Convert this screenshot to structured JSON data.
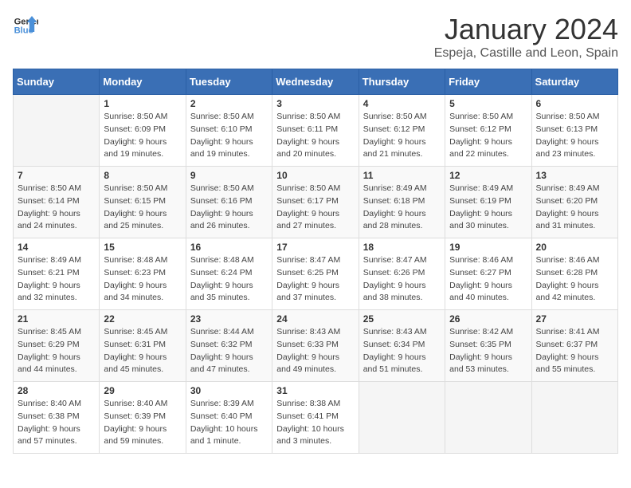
{
  "logo": {
    "line1": "General",
    "line2": "Blue"
  },
  "title": "January 2024",
  "location": "Espeja, Castille and Leon, Spain",
  "days_of_week": [
    "Sunday",
    "Monday",
    "Tuesday",
    "Wednesday",
    "Thursday",
    "Friday",
    "Saturday"
  ],
  "weeks": [
    [
      {
        "day": "",
        "sunrise": "",
        "sunset": "",
        "daylight": ""
      },
      {
        "day": "1",
        "sunrise": "Sunrise: 8:50 AM",
        "sunset": "Sunset: 6:09 PM",
        "daylight": "Daylight: 9 hours and 19 minutes."
      },
      {
        "day": "2",
        "sunrise": "Sunrise: 8:50 AM",
        "sunset": "Sunset: 6:10 PM",
        "daylight": "Daylight: 9 hours and 19 minutes."
      },
      {
        "day": "3",
        "sunrise": "Sunrise: 8:50 AM",
        "sunset": "Sunset: 6:11 PM",
        "daylight": "Daylight: 9 hours and 20 minutes."
      },
      {
        "day": "4",
        "sunrise": "Sunrise: 8:50 AM",
        "sunset": "Sunset: 6:12 PM",
        "daylight": "Daylight: 9 hours and 21 minutes."
      },
      {
        "day": "5",
        "sunrise": "Sunrise: 8:50 AM",
        "sunset": "Sunset: 6:12 PM",
        "daylight": "Daylight: 9 hours and 22 minutes."
      },
      {
        "day": "6",
        "sunrise": "Sunrise: 8:50 AM",
        "sunset": "Sunset: 6:13 PM",
        "daylight": "Daylight: 9 hours and 23 minutes."
      }
    ],
    [
      {
        "day": "7",
        "sunrise": "Sunrise: 8:50 AM",
        "sunset": "Sunset: 6:14 PM",
        "daylight": "Daylight: 9 hours and 24 minutes."
      },
      {
        "day": "8",
        "sunrise": "Sunrise: 8:50 AM",
        "sunset": "Sunset: 6:15 PM",
        "daylight": "Daylight: 9 hours and 25 minutes."
      },
      {
        "day": "9",
        "sunrise": "Sunrise: 8:50 AM",
        "sunset": "Sunset: 6:16 PM",
        "daylight": "Daylight: 9 hours and 26 minutes."
      },
      {
        "day": "10",
        "sunrise": "Sunrise: 8:50 AM",
        "sunset": "Sunset: 6:17 PM",
        "daylight": "Daylight: 9 hours and 27 minutes."
      },
      {
        "day": "11",
        "sunrise": "Sunrise: 8:49 AM",
        "sunset": "Sunset: 6:18 PM",
        "daylight": "Daylight: 9 hours and 28 minutes."
      },
      {
        "day": "12",
        "sunrise": "Sunrise: 8:49 AM",
        "sunset": "Sunset: 6:19 PM",
        "daylight": "Daylight: 9 hours and 30 minutes."
      },
      {
        "day": "13",
        "sunrise": "Sunrise: 8:49 AM",
        "sunset": "Sunset: 6:20 PM",
        "daylight": "Daylight: 9 hours and 31 minutes."
      }
    ],
    [
      {
        "day": "14",
        "sunrise": "Sunrise: 8:49 AM",
        "sunset": "Sunset: 6:21 PM",
        "daylight": "Daylight: 9 hours and 32 minutes."
      },
      {
        "day": "15",
        "sunrise": "Sunrise: 8:48 AM",
        "sunset": "Sunset: 6:23 PM",
        "daylight": "Daylight: 9 hours and 34 minutes."
      },
      {
        "day": "16",
        "sunrise": "Sunrise: 8:48 AM",
        "sunset": "Sunset: 6:24 PM",
        "daylight": "Daylight: 9 hours and 35 minutes."
      },
      {
        "day": "17",
        "sunrise": "Sunrise: 8:47 AM",
        "sunset": "Sunset: 6:25 PM",
        "daylight": "Daylight: 9 hours and 37 minutes."
      },
      {
        "day": "18",
        "sunrise": "Sunrise: 8:47 AM",
        "sunset": "Sunset: 6:26 PM",
        "daylight": "Daylight: 9 hours and 38 minutes."
      },
      {
        "day": "19",
        "sunrise": "Sunrise: 8:46 AM",
        "sunset": "Sunset: 6:27 PM",
        "daylight": "Daylight: 9 hours and 40 minutes."
      },
      {
        "day": "20",
        "sunrise": "Sunrise: 8:46 AM",
        "sunset": "Sunset: 6:28 PM",
        "daylight": "Daylight: 9 hours and 42 minutes."
      }
    ],
    [
      {
        "day": "21",
        "sunrise": "Sunrise: 8:45 AM",
        "sunset": "Sunset: 6:29 PM",
        "daylight": "Daylight: 9 hours and 44 minutes."
      },
      {
        "day": "22",
        "sunrise": "Sunrise: 8:45 AM",
        "sunset": "Sunset: 6:31 PM",
        "daylight": "Daylight: 9 hours and 45 minutes."
      },
      {
        "day": "23",
        "sunrise": "Sunrise: 8:44 AM",
        "sunset": "Sunset: 6:32 PM",
        "daylight": "Daylight: 9 hours and 47 minutes."
      },
      {
        "day": "24",
        "sunrise": "Sunrise: 8:43 AM",
        "sunset": "Sunset: 6:33 PM",
        "daylight": "Daylight: 9 hours and 49 minutes."
      },
      {
        "day": "25",
        "sunrise": "Sunrise: 8:43 AM",
        "sunset": "Sunset: 6:34 PM",
        "daylight": "Daylight: 9 hours and 51 minutes."
      },
      {
        "day": "26",
        "sunrise": "Sunrise: 8:42 AM",
        "sunset": "Sunset: 6:35 PM",
        "daylight": "Daylight: 9 hours and 53 minutes."
      },
      {
        "day": "27",
        "sunrise": "Sunrise: 8:41 AM",
        "sunset": "Sunset: 6:37 PM",
        "daylight": "Daylight: 9 hours and 55 minutes."
      }
    ],
    [
      {
        "day": "28",
        "sunrise": "Sunrise: 8:40 AM",
        "sunset": "Sunset: 6:38 PM",
        "daylight": "Daylight: 9 hours and 57 minutes."
      },
      {
        "day": "29",
        "sunrise": "Sunrise: 8:40 AM",
        "sunset": "Sunset: 6:39 PM",
        "daylight": "Daylight: 9 hours and 59 minutes."
      },
      {
        "day": "30",
        "sunrise": "Sunrise: 8:39 AM",
        "sunset": "Sunset: 6:40 PM",
        "daylight": "Daylight: 10 hours and 1 minute."
      },
      {
        "day": "31",
        "sunrise": "Sunrise: 8:38 AM",
        "sunset": "Sunset: 6:41 PM",
        "daylight": "Daylight: 10 hours and 3 minutes."
      },
      {
        "day": "",
        "sunrise": "",
        "sunset": "",
        "daylight": ""
      },
      {
        "day": "",
        "sunrise": "",
        "sunset": "",
        "daylight": ""
      },
      {
        "day": "",
        "sunrise": "",
        "sunset": "",
        "daylight": ""
      }
    ]
  ]
}
